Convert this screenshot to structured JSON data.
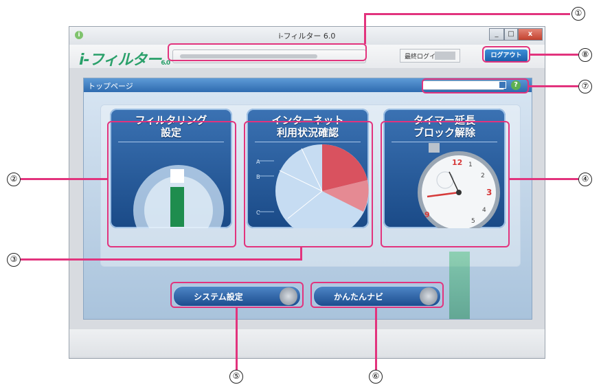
{
  "window": {
    "title": "i-フィルター 6.0",
    "app_icon": "i",
    "controls": [
      "_",
      "□",
      "x"
    ]
  },
  "appbar": {
    "logo_text": "i-フィルター",
    "logo_version": "6.0",
    "login_label": "最終ログイン",
    "logout_label": "ログアウト"
  },
  "page": {
    "title": "トップページ",
    "help_icon": "?"
  },
  "tiles": [
    {
      "title": "フィルタリング\n設定"
    },
    {
      "title": "インターネット\n利用状況確認",
      "chart_letters": [
        "A",
        "B",
        "C"
      ]
    },
    {
      "title": "タイマー延長\nブロック解除",
      "clock_numbers": [
        "12",
        "1",
        "2",
        "3",
        "4",
        "5",
        "9"
      ]
    }
  ],
  "nav_buttons": {
    "system_settings": "システム設定",
    "easy_navi": "かんたんナビ"
  },
  "callouts": [
    "①",
    "②",
    "③",
    "④",
    "⑤",
    "⑥",
    "⑦",
    "⑧"
  ],
  "colors": {
    "annotation": "#e2337d",
    "tile_blue": "#1a4a87",
    "brand_green": "#2aa06a",
    "logout_blue": "#1a5ea8"
  }
}
